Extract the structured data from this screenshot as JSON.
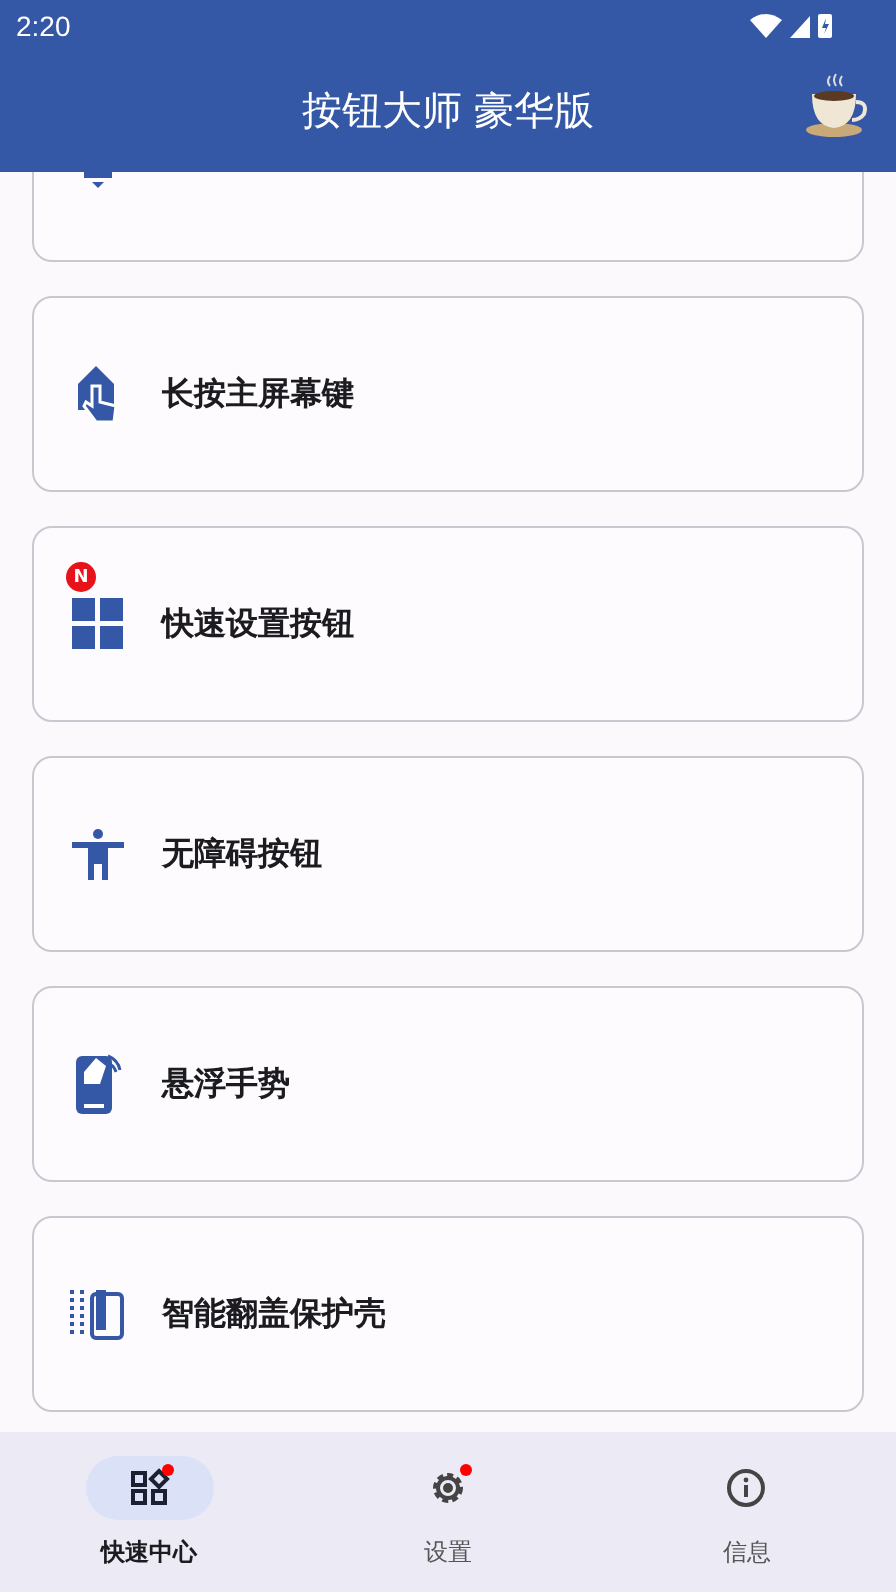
{
  "status_bar": {
    "time": "2:20"
  },
  "app_bar": {
    "title": "按钮大师 豪华版"
  },
  "cards": [
    {
      "kind": "partial"
    },
    {
      "kind": "home",
      "label": "长按主屏幕键"
    },
    {
      "kind": "tiles",
      "label": "快速设置按钮",
      "badge": "N"
    },
    {
      "kind": "accessibility",
      "label": "无障碍按钮"
    },
    {
      "kind": "gesture",
      "label": "悬浮手势"
    },
    {
      "kind": "cover",
      "label": "智能翻盖保护壳"
    }
  ],
  "bottom_nav": [
    {
      "kind": "hub",
      "label": "快速中心",
      "selected": true,
      "dot": true
    },
    {
      "kind": "settings",
      "label": "设置",
      "selected": false,
      "dot": true
    },
    {
      "kind": "info",
      "label": "信息",
      "selected": false,
      "dot": false
    }
  ]
}
